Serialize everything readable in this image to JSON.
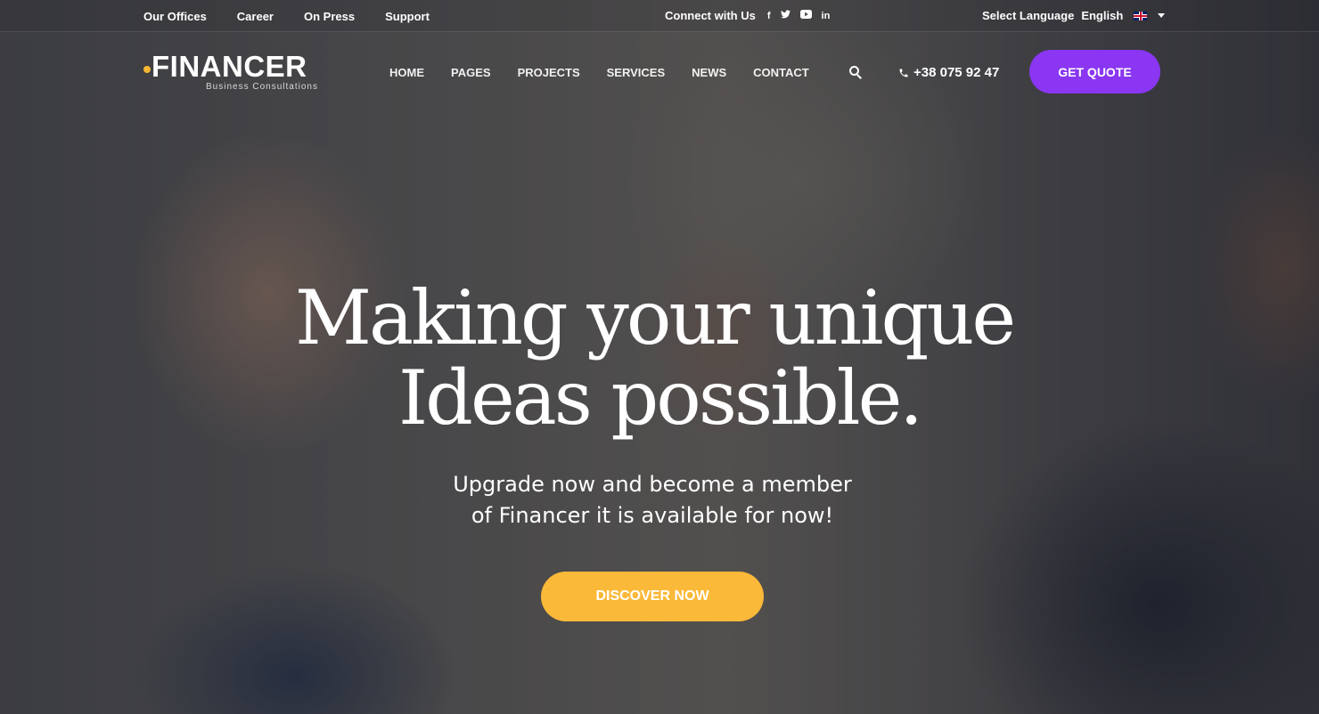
{
  "topbar": {
    "links": [
      "Our Offices",
      "Career",
      "On Press",
      "Support"
    ],
    "connect_label": "Connect with Us",
    "social": {
      "facebook": "f",
      "twitter": "🐦",
      "youtube": "▶",
      "linkedin": "in"
    },
    "language_label": "Select Language",
    "language_value": "English"
  },
  "header": {
    "logo_name": "FINANCER",
    "logo_tagline": "Business Consultations",
    "nav": [
      "HOME",
      "PAGES",
      "PROJECTS",
      "SERVICES",
      "NEWS",
      "CONTACT"
    ],
    "phone": "+38 075 92 47",
    "quote_label": "GET QUOTE"
  },
  "hero": {
    "headline_line1": "Making your unique",
    "headline_line2": "Ideas possible.",
    "subtitle_line1": "Upgrade now and become a member",
    "subtitle_line2": "of Financer it is available for now!",
    "cta_label": "DISCOVER NOW"
  },
  "colors": {
    "accent_purple": "#8a36f2",
    "accent_yellow": "#fbb93a",
    "logo_dot": "#f7b733"
  }
}
